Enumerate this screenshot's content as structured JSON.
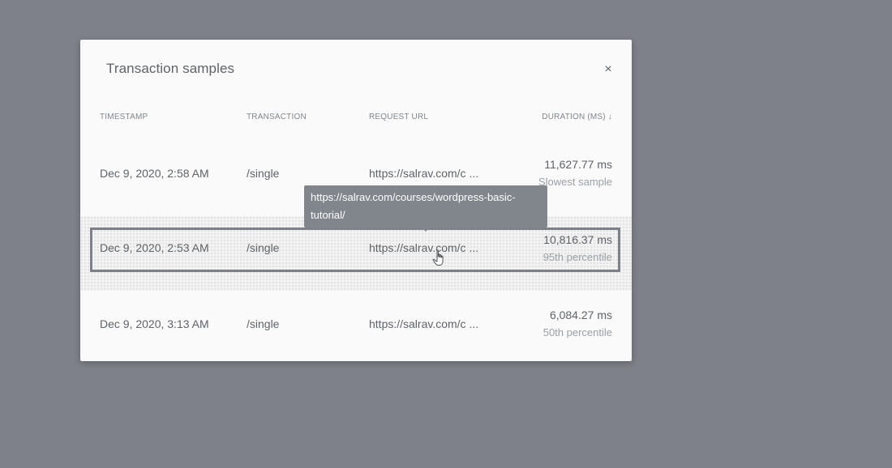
{
  "dialog": {
    "title": "Transaction samples",
    "close_icon": "close-icon",
    "close_glyph": "×"
  },
  "table": {
    "headers": {
      "timestamp": "TIMESTAMP",
      "transaction": "TRANSACTION",
      "request_url": "REQUEST URL",
      "duration": "DURATION (MS) ↓"
    },
    "rows": [
      {
        "timestamp": "Dec 9, 2020, 2:58 AM",
        "transaction": "/single",
        "request_url": "https://salrav.com/c ...",
        "duration": "11,627.77 ms",
        "label": "Slowest sample"
      },
      {
        "timestamp": "Dec 9, 2020, 2:53 AM",
        "transaction": "/single",
        "request_url": "https://salrav.com/c ...",
        "duration": "10,816.37 ms",
        "label": "95th percentile"
      },
      {
        "timestamp": "Dec 9, 2020, 3:13 AM",
        "transaction": "/single",
        "request_url": "https://salrav.com/c ...",
        "duration": "6,084.27 ms",
        "label": "50th percentile"
      }
    ]
  },
  "tooltip": {
    "text": "https://salrav.com/courses/wordpress-basic-tutorial/"
  },
  "cursor": {
    "icon": "hand-pointer-icon"
  },
  "colors": {
    "backdrop": "#7e8189",
    "dialog_bg": "#fafafa",
    "text": "#5f6368",
    "muted_text": "#9aa0a6",
    "tooltip_bg": "#80868b"
  }
}
